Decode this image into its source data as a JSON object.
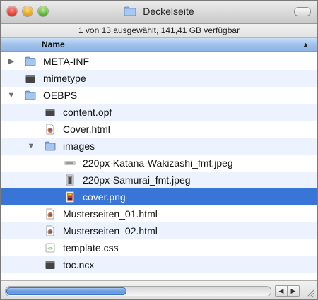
{
  "window": {
    "title": "Deckelseite",
    "status": "1 von 13 ausgewählt, 141,41 GB verfügbar"
  },
  "columns": {
    "name_header": "Name",
    "sort_indicator": "▲"
  },
  "rows": [
    {
      "label": "META-INF",
      "icon": "folder-icon",
      "disclosure": "▶",
      "selected": false
    },
    {
      "label": "mimetype",
      "icon": "generic-file-icon",
      "disclosure": "",
      "selected": false
    },
    {
      "label": "OEBPS",
      "icon": "folder-icon",
      "disclosure": "▼",
      "selected": false
    },
    {
      "label": "content.opf",
      "icon": "generic-file-icon",
      "disclosure": "",
      "selected": false
    },
    {
      "label": "Cover.html",
      "icon": "html-document-icon",
      "disclosure": "",
      "selected": false
    },
    {
      "label": "images",
      "icon": "folder-icon",
      "disclosure": "▼",
      "selected": false
    },
    {
      "label": "220px-Katana-Wakizashi_fmt.jpeg",
      "icon": "image-thumbnail-icon",
      "disclosure": "",
      "selected": false
    },
    {
      "label": "220px-Samurai_fmt.jpeg",
      "icon": "image-thumbnail-icon",
      "disclosure": "",
      "selected": false
    },
    {
      "label": "cover.png",
      "icon": "png-image-icon",
      "disclosure": "",
      "selected": true
    },
    {
      "label": "Musterseiten_01.html",
      "icon": "html-document-icon",
      "disclosure": "",
      "selected": false
    },
    {
      "label": "Musterseiten_02.html",
      "icon": "html-document-icon",
      "disclosure": "",
      "selected": false
    },
    {
      "label": "template.css",
      "icon": "css-document-icon",
      "disclosure": "",
      "selected": false
    },
    {
      "label": "toc.ncx",
      "icon": "generic-file-icon",
      "disclosure": "",
      "selected": false
    }
  ],
  "scrollbar": {
    "left_arrow": "◀",
    "right_arrow": "▶"
  },
  "colors": {
    "selection": "#3875d7",
    "alt_row": "#edf3fe",
    "folder_blue": "#7fa9de"
  }
}
